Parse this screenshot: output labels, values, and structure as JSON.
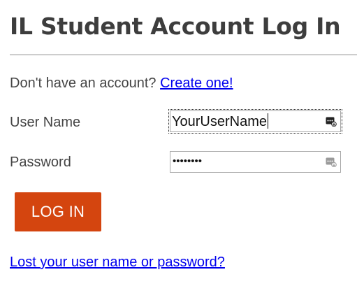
{
  "page": {
    "title": "IL Student Account Log In"
  },
  "signup": {
    "prompt": "Don't have an account?",
    "link_label": "Create one!"
  },
  "form": {
    "username_label": "User Name",
    "username_value": "YourUserName",
    "password_label": "Password",
    "password_masked": "••••••••",
    "field_icon": "password-manager-key-icon"
  },
  "actions": {
    "login_label": "LOG IN",
    "login_color": "#d4450f",
    "lost_link_label": "Lost your user name or password?",
    "link_color": "#0000ee"
  }
}
